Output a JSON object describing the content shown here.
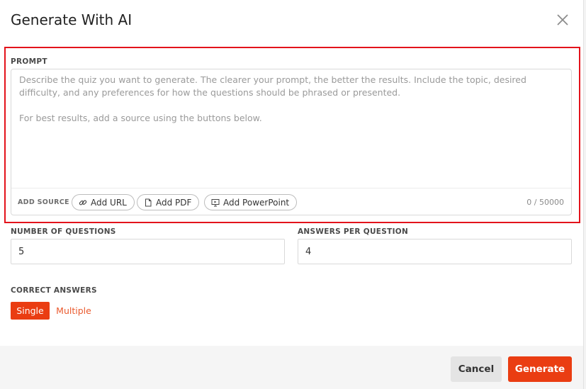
{
  "dialog": {
    "title": "Generate With AI"
  },
  "prompt": {
    "label": "PROMPT",
    "placeholder": "Describe the quiz you want to generate. The clearer your prompt, the better the results. Include the topic, desired difficulty, and any preferences for how the questions should be phrased or presented.\n\nFor best results, add a source using the buttons below.",
    "source_label": "ADD SOURCE",
    "buttons": {
      "url": "Add URL",
      "pdf": "Add PDF",
      "ppt": "Add PowerPoint"
    },
    "counter": "0 / 50000"
  },
  "questions": {
    "label": "NUMBER OF QUESTIONS",
    "value": "5"
  },
  "answers": {
    "label": "ANSWERS PER QUESTION",
    "value": "4"
  },
  "correct": {
    "label": "CORRECT ANSWERS",
    "single": "Single",
    "multiple": "Multiple",
    "selected": "Single"
  },
  "footer": {
    "cancel": "Cancel",
    "generate": "Generate"
  },
  "colors": {
    "accent": "#ea3d12",
    "highlight": "#e3131b"
  },
  "icons": {
    "close": "close-icon",
    "url": "link-icon",
    "pdf": "document-icon",
    "ppt": "presentation-icon"
  }
}
